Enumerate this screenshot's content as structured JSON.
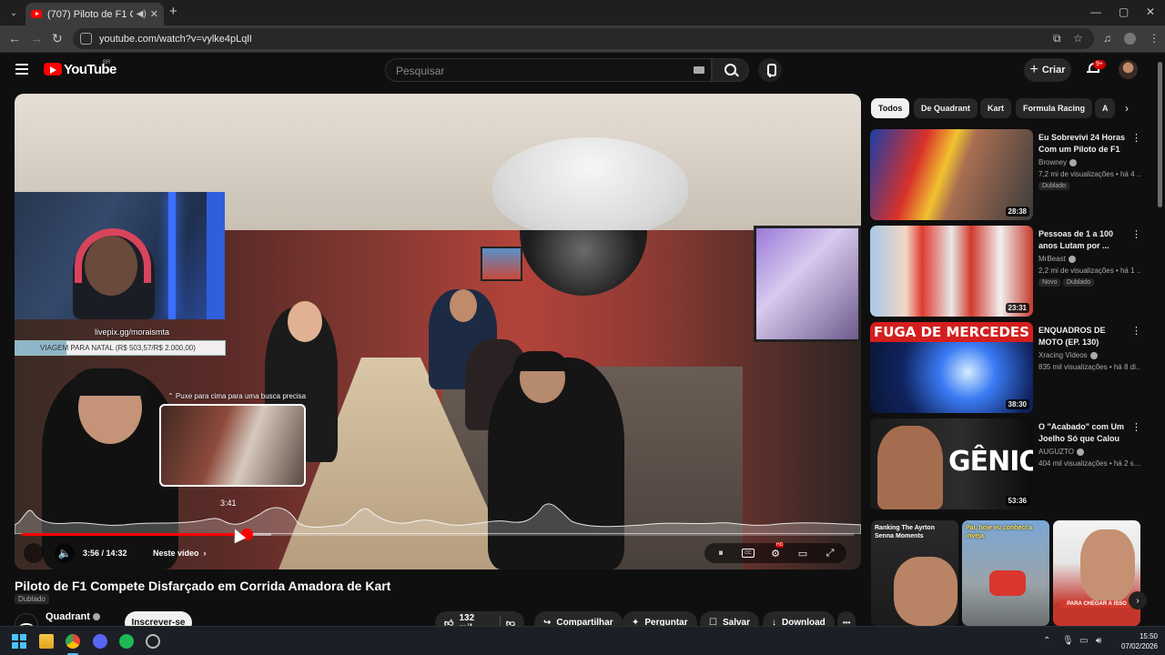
{
  "browser": {
    "tab_title": "(707) Piloto de F1 Compete",
    "url": "youtube.com/watch?v=vylke4pLqlI",
    "new_tab": "+",
    "win_min": "—",
    "win_max": "▢",
    "win_close": "✕"
  },
  "masthead": {
    "logo_text": "YouTube",
    "country": "BR",
    "search_placeholder": "Pesquisar",
    "create_label": "Criar",
    "notifications": "9+"
  },
  "player": {
    "overlay_link": "livepix.gg/moraismta",
    "goal_text": "VIAGEM PARA NATAL (R$ 503,57/R$ 2.000,00)",
    "goal_progress": 0.2518,
    "pull_hint": "⌃ Puxe para cima para uma busca precisa",
    "preview_time": "3:41",
    "current_time": "3:56 / 14:32",
    "chapter": "Neste vídeo",
    "progress": 0.27,
    "buffered": 0.3,
    "hover": 0.255
  },
  "video": {
    "title": "Piloto de F1 Compete Disfarçado em Corrida Amadora de Kart",
    "dubbed": "Dublado",
    "channel": "Quadrant",
    "subscribe": "Inscrever-se",
    "likes": "132 mil",
    "share": "Compartilhar",
    "ask": "Perguntar",
    "save": "Salvar",
    "download": "Download",
    "more": "•••"
  },
  "chips": [
    "Todos",
    "De Quadrant",
    "Kart",
    "Formula Racing",
    "A"
  ],
  "recommendations": [
    {
      "title": "Eu Sobrevivi 24 Horas Com um Piloto de F1",
      "channel": "Browney",
      "stats": "7,2 mi de visualizações • há 4 …",
      "badge": "Dublado",
      "duration": "28:38",
      "badge2": ""
    },
    {
      "title": "Pessoas de 1 a 100 anos Lutam por ...",
      "channel": "MrBeast",
      "stats": "2,2 mi de visualizações • há 1 …",
      "badge": "Dublado",
      "badge2": "Novo",
      "duration": "23:31"
    },
    {
      "title": "ENQUADROS DE MOTO (EP. 130)",
      "channel": "Xracing Videos",
      "stats": "835 mil visualizações • há 8 di…",
      "badge": "",
      "badge2": "",
      "duration": "38:30",
      "thumb_text": "FUGA DE MERCEDES"
    },
    {
      "title": "O \"Acabado\" com Um Joelho Só que Calou ...",
      "channel": "AUGUZTO",
      "stats": "404 mil visualizações • há 2 s…",
      "badge": "",
      "badge2": "",
      "duration": "53:36",
      "thumb_text": "GÊNIO"
    }
  ],
  "shorts": [
    {
      "text": "Ranking The Ayrton Senna Moments"
    },
    {
      "text": "Pai, hoje eu conheci a inveja"
    },
    {
      "text": "PARA CHEGAR A ISSO"
    }
  ],
  "taskbar": {
    "time": "15:50",
    "date": "07/02/2026"
  },
  "colors": {
    "accent": "#ff0000",
    "background": "#0f0f0f",
    "chip_active": "#f1f1f1"
  }
}
